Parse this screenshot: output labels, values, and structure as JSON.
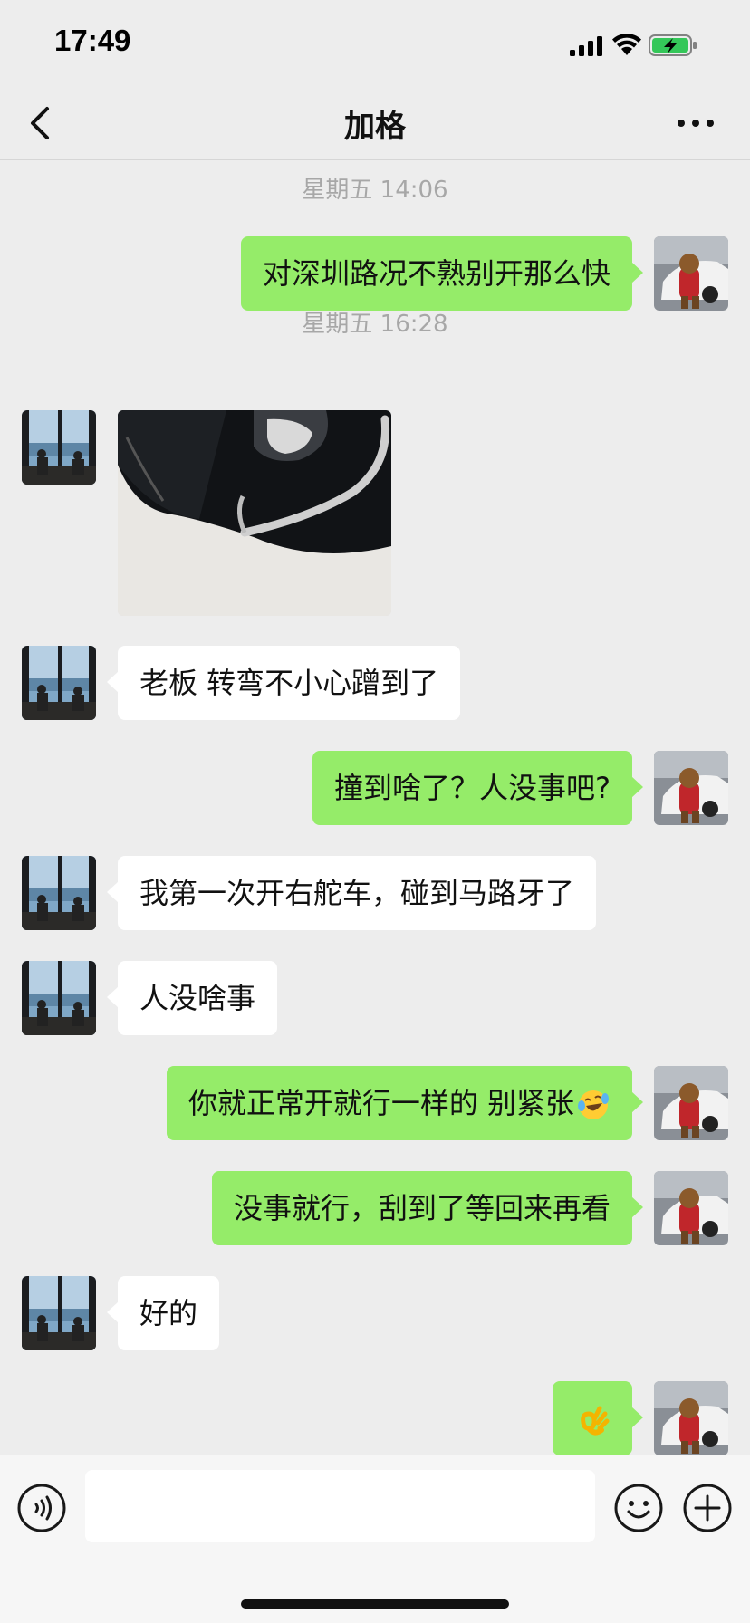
{
  "status_bar": {
    "time": "17:49",
    "icons": [
      "signal-icon",
      "wifi-icon",
      "battery-charging-icon"
    ]
  },
  "nav": {
    "title": "加格",
    "back_icon": "chevron-left-icon",
    "more_icon": "more-dots-icon"
  },
  "chat": {
    "timestamps": [
      "星期五 14:06",
      "星期五 16:28"
    ],
    "messages": [
      {
        "side": "out",
        "text": "对深圳路况不熟别开那么快"
      },
      {
        "side": "in",
        "type": "image",
        "text": ""
      },
      {
        "side": "in",
        "text": "老板 转弯不小心蹭到了"
      },
      {
        "side": "out",
        "text": "撞到啥了？人没事吧?"
      },
      {
        "side": "in",
        "text": "我第一次开右舵车，碰到马路牙了"
      },
      {
        "side": "in",
        "text": "人没啥事"
      },
      {
        "side": "out",
        "text": "你就正常开就行一样的 别紧张",
        "emoji": "crying-laughing-emoji"
      },
      {
        "side": "out",
        "text": "没事就行，刮到了等回来再看"
      },
      {
        "side": "in",
        "text": "好的"
      },
      {
        "side": "out",
        "text": "",
        "emoji": "ok-hand-emoji"
      }
    ]
  },
  "input_bar": {
    "placeholder": "",
    "icons": [
      "voice-icon",
      "emoji-icon",
      "plus-icon"
    ]
  },
  "colors": {
    "background": "#ededed",
    "outgoing_bubble": "#95ec69",
    "incoming_bubble": "#ffffff",
    "timestamp_text": "#a7a7a7",
    "battery_green": "#34c759"
  }
}
